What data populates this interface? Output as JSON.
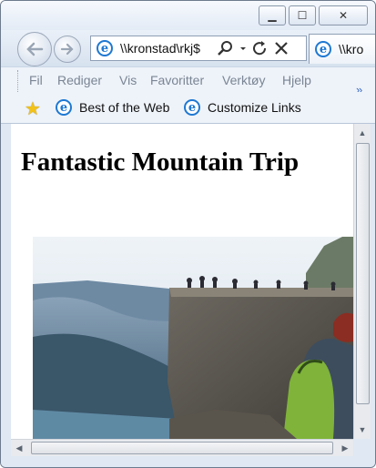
{
  "window": {
    "controls": {
      "minimize": "▁",
      "maximize": "☐",
      "close": "✕"
    }
  },
  "nav": {
    "back_icon": "back-arrow-icon",
    "forward_icon": "forward-arrow-icon",
    "address": "\\\\kronstad\\rkj$",
    "tab_label": "\\\\kro"
  },
  "menu": [
    "Fil",
    "Rediger",
    "Vis",
    "Favoritter",
    "Verktøy",
    "Hjelp"
  ],
  "favorites": {
    "links": [
      "Best of the Web",
      "Customize Links"
    ],
    "chevron": "»"
  },
  "page": {
    "title": "Fantastic Mountain Trip"
  },
  "colors": {
    "accent": "#1e78d2",
    "frame": "#dfe8f3"
  }
}
